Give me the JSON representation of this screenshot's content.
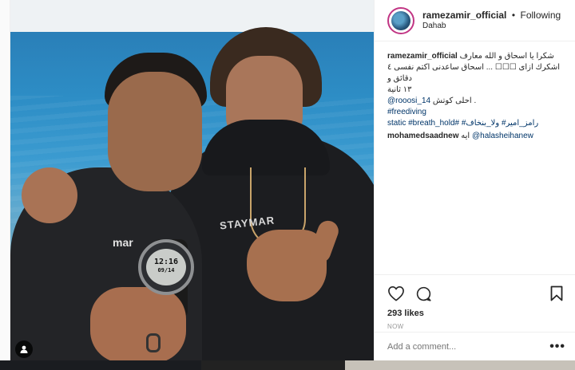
{
  "post": {
    "username": "ramezamir_official",
    "separator": "•",
    "follow_status": "Following",
    "location": "Dahab",
    "watch_time": "12:16",
    "watch_date": "09/14"
  },
  "caption": {
    "user": "ramezamir_official",
    "line1": "شكرا يا اسحاق و الله معارف",
    "line2": "اشكرك ازاى ☐☐☐ ... اسحاق ساعدنى اكتم نفسى ٤ دقائق و",
    "line3": "١٣ ثانية",
    "mention": "@rooosi_14",
    "mention_suffix": "احلى كوتش",
    "mention_tail": ".",
    "hashtag1": "#freediving",
    "hashtag_line2": "رامز_امير# ولا_بنخاف# #static #breath_hold"
  },
  "comment": {
    "user": "mohamedsaadnew",
    "prefix": "ايه",
    "mention": "@halasheihanew"
  },
  "engagement": {
    "likes": "293 likes",
    "time": "NOW"
  },
  "add_comment": {
    "placeholder": "Add a comment...",
    "more": "•••"
  },
  "icons": [
    "heart-icon",
    "comment-icon",
    "bookmark-icon",
    "more-icon",
    "tag-person-icon"
  ],
  "colors": {
    "link": "#003569",
    "text": "#262626",
    "muted": "#999999",
    "border": "#efefef"
  }
}
